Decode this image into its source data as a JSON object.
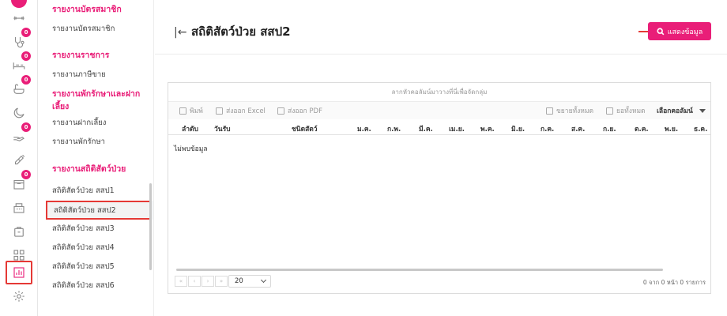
{
  "menu": {
    "sections": [
      {
        "heading": "รายงานบัตรสมาชิก",
        "items": [
          "รายงานบัตรสมาชิก"
        ]
      },
      {
        "heading": "รายงานราชการ",
        "items": [
          "รายงานภาษีขาย"
        ]
      },
      {
        "heading": "รายงานพักรักษาและฝากเลี้ยง",
        "items": [
          "รายงานฝากเลี้ยง",
          "รายงานพักรักษา"
        ]
      },
      {
        "heading": "รายงานสถิติสัตว์ป่วย",
        "items": [
          "สถิติสัตว์ป่วย สสป1",
          "สถิติสัตว์ป่วย สสป2",
          "สถิติสัตว์ป่วย สสป3",
          "สถิติสัตว์ป่วย สสป4",
          "สถิติสัตว์ป่วย สสป5",
          "สถิติสัตว์ป่วย สสป6"
        ]
      }
    ],
    "selected": "สถิติสัตว์ป่วย สสป2"
  },
  "rail": {
    "badges": [
      "0",
      "0",
      "0",
      "0",
      "0"
    ],
    "icons": [
      "dumbbell-icon",
      "stethoscope-icon",
      "bed-icon",
      "bath-icon",
      "moon-icon",
      "hand-icon",
      "syringe-icon",
      "box-icon",
      "cash-register-icon",
      "bag-icon",
      "grid-icon",
      "report-chart-icon",
      "gear-icon"
    ]
  },
  "header": {
    "back_icon": "collapse-left-icon",
    "title": "สถิติสัตว์ป่วย สสป2",
    "show_button": "แสดงข้อมูล"
  },
  "grid": {
    "group_panel": "ลากหัวคอลัมน์มาวางที่นี่เพื่อจัดกลุ่ม",
    "toolbar": {
      "print": "พิมพ์",
      "export_excel": "ส่งออก Excel",
      "export_pdf": "ส่งออก PDF",
      "expand_all": "ขยายทั้งหมด",
      "collapse_all": "ยอทั้งหมด",
      "choose_columns": "เลือกคอลัมน์"
    },
    "columns": [
      "ลำดับ",
      "วันรับ",
      "ชนิดสัตว์",
      "ม.ค.",
      "ก.พ.",
      "มี.ค.",
      "เม.ย.",
      "พ.ค.",
      "มิ.ย.",
      "ก.ค.",
      "ส.ค.",
      "ก.ย.",
      "ต.ค.",
      "พ.ย.",
      "ธ.ค."
    ],
    "empty_text": "ไม่พบข้อมูล",
    "pager": {
      "first": "«",
      "prev": "‹",
      "next": "›",
      "last": "»"
    },
    "page_size": "20",
    "page_info": "0 จาก 0 หน้า 0 รายการ"
  },
  "colors": {
    "accent": "#e91e78",
    "highlight": "#e53935"
  }
}
